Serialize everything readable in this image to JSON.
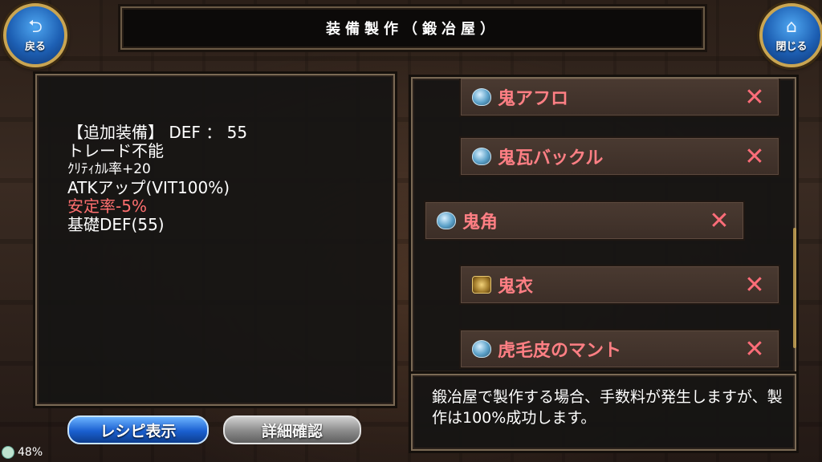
{
  "header": {
    "title": "装備製作（鍛冶屋）",
    "back_label": "戻る",
    "close_label": "閉じる"
  },
  "detail": {
    "lines": [
      "【追加装備】 DEF ： 55",
      "トレード不能",
      "ｸﾘﾃｨｶﾙ率+20",
      "ATKアップ(VIT100%)",
      "安定率-5%",
      "基礎DEF(55)"
    ]
  },
  "items": [
    {
      "name": "鬼アフロ",
      "mark": "✕",
      "icon": "helmet-icon"
    },
    {
      "name": "鬼瓦バックル",
      "mark": "✕",
      "icon": "helmet-icon"
    },
    {
      "name": "鬼角",
      "mark": "✕",
      "icon": "helmet-icon"
    },
    {
      "name": "鬼衣",
      "mark": "✕",
      "icon": "armor-icon"
    },
    {
      "name": "虎毛皮のマント",
      "mark": "✕",
      "icon": "helmet-icon"
    }
  ],
  "message": "鍛冶屋で製作する場合、手数料が発生しますが、製作は100%成功します。",
  "buttons": {
    "recipe": "レシピ表示",
    "detail": "詳細確認"
  },
  "status": {
    "battery": "48%"
  },
  "colors": {
    "item_name": "#ff7f84",
    "warning": "#ff6f6f",
    "blue_button": "#1a5fd0",
    "gray_button": "#8a8a8a"
  }
}
